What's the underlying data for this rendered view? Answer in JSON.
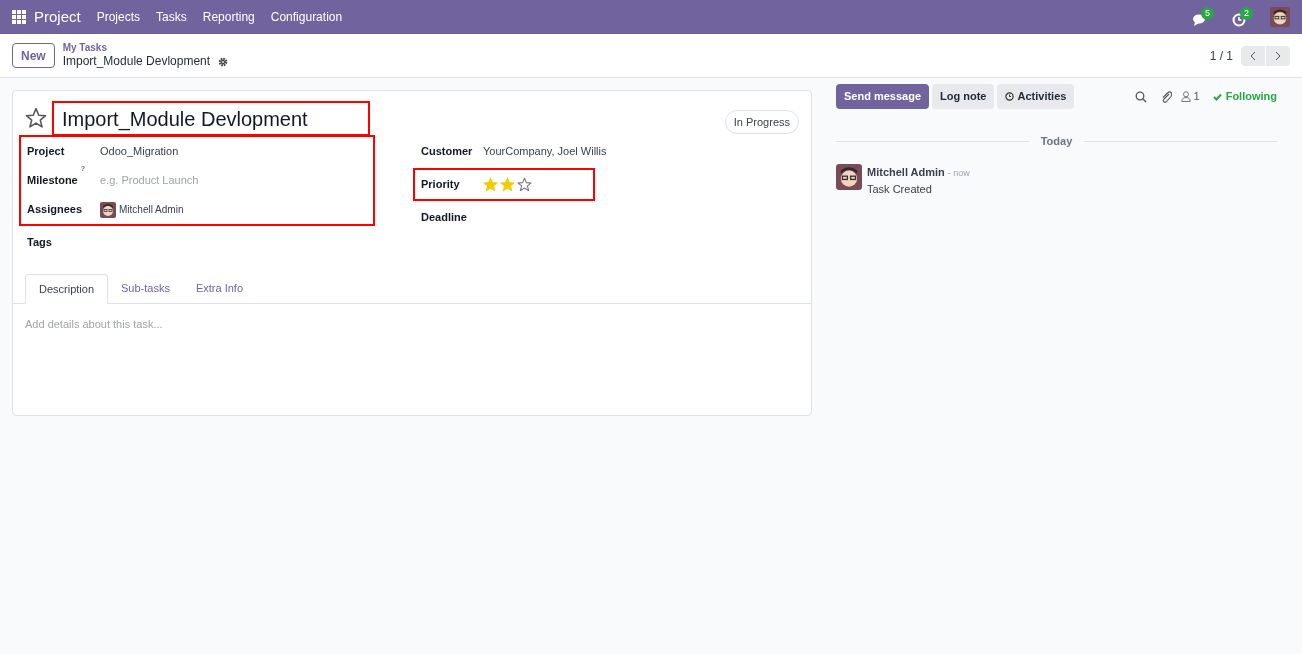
{
  "navbar": {
    "app": "Project",
    "menu": [
      "Projects",
      "Tasks",
      "Reporting",
      "Configuration"
    ],
    "messages_count": "5",
    "activities_count": "2"
  },
  "control_panel": {
    "new_button": "New",
    "breadcrumb": "My Tasks",
    "record": "Import_Module Devlopment",
    "pager": "1 / 1"
  },
  "form": {
    "favorite": false,
    "title": "Import_Module Devlopment",
    "title_highlighted": true,
    "stage": "In Progress",
    "left_fields": [
      {
        "kind": "text",
        "label": "Project",
        "value": "Odoo_Migration",
        "highlighted": true
      },
      {
        "kind": "placeholder",
        "label": "Milestone",
        "help": "?",
        "placeholder": "e.g. Product Launch",
        "highlighted": true
      },
      {
        "kind": "user",
        "label": "Assignees",
        "value": "Mitchell Admin",
        "highlighted": true
      },
      {
        "kind": "empty",
        "label": "Tags"
      }
    ],
    "right_fields": [
      {
        "kind": "text",
        "label": "Customer",
        "value": "YourCompany, Joel Willis"
      },
      {
        "kind": "stars",
        "label": "Priority",
        "stars": 2,
        "highlighted": true
      },
      {
        "kind": "empty",
        "label": "Deadline"
      }
    ],
    "tabs": [
      {
        "label": "Description",
        "selected": true
      },
      {
        "label": "Sub-tasks",
        "selected": false
      },
      {
        "label": "Extra Info",
        "selected": false
      }
    ],
    "description_placeholder": "Add details about this task..."
  },
  "chatter": {
    "buttons": [
      {
        "label": "Send message",
        "kind": "primary"
      },
      {
        "label": "Log note",
        "kind": "secondary"
      },
      {
        "label": "Activities",
        "kind": "activities"
      }
    ],
    "followers_count": "1",
    "following": "Following",
    "date_separator": "Today",
    "messages": [
      {
        "author": "Mitchell Admin",
        "time": "- now",
        "body": "Task Created"
      }
    ]
  }
}
